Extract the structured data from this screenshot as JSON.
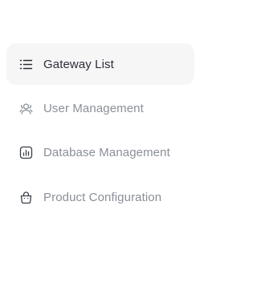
{
  "sidebar": {
    "items": [
      {
        "label": "Gateway List",
        "icon": "list-icon",
        "active": true
      },
      {
        "label": "User Management",
        "icon": "users-icon",
        "active": false
      },
      {
        "label": "Database Management",
        "icon": "database-chart-icon",
        "active": false
      },
      {
        "label": "Product Configuration",
        "icon": "shopping-bag-icon",
        "active": false
      }
    ]
  },
  "colors": {
    "active_background": "#f6f6f7",
    "active_text": "#2b2f36",
    "inactive_text": "#8a8f98"
  }
}
